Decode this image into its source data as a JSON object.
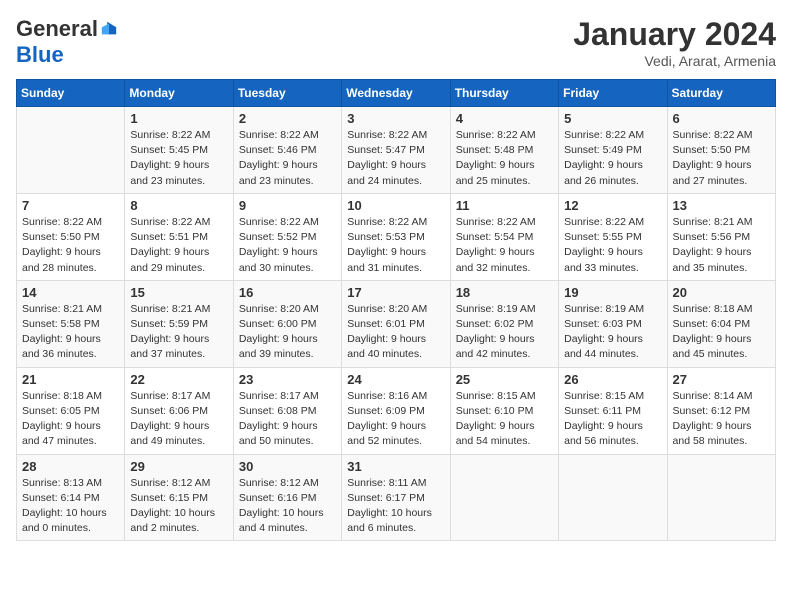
{
  "header": {
    "logo_general": "General",
    "logo_blue": "Blue",
    "month_title": "January 2024",
    "location": "Vedi, Ararat, Armenia"
  },
  "weekdays": [
    "Sunday",
    "Monday",
    "Tuesday",
    "Wednesday",
    "Thursday",
    "Friday",
    "Saturday"
  ],
  "weeks": [
    [
      {
        "day": "",
        "info": ""
      },
      {
        "day": "1",
        "info": "Sunrise: 8:22 AM\nSunset: 5:45 PM\nDaylight: 9 hours\nand 23 minutes."
      },
      {
        "day": "2",
        "info": "Sunrise: 8:22 AM\nSunset: 5:46 PM\nDaylight: 9 hours\nand 23 minutes."
      },
      {
        "day": "3",
        "info": "Sunrise: 8:22 AM\nSunset: 5:47 PM\nDaylight: 9 hours\nand 24 minutes."
      },
      {
        "day": "4",
        "info": "Sunrise: 8:22 AM\nSunset: 5:48 PM\nDaylight: 9 hours\nand 25 minutes."
      },
      {
        "day": "5",
        "info": "Sunrise: 8:22 AM\nSunset: 5:49 PM\nDaylight: 9 hours\nand 26 minutes."
      },
      {
        "day": "6",
        "info": "Sunrise: 8:22 AM\nSunset: 5:50 PM\nDaylight: 9 hours\nand 27 minutes."
      }
    ],
    [
      {
        "day": "7",
        "info": "Sunrise: 8:22 AM\nSunset: 5:50 PM\nDaylight: 9 hours\nand 28 minutes."
      },
      {
        "day": "8",
        "info": "Sunrise: 8:22 AM\nSunset: 5:51 PM\nDaylight: 9 hours\nand 29 minutes."
      },
      {
        "day": "9",
        "info": "Sunrise: 8:22 AM\nSunset: 5:52 PM\nDaylight: 9 hours\nand 30 minutes."
      },
      {
        "day": "10",
        "info": "Sunrise: 8:22 AM\nSunset: 5:53 PM\nDaylight: 9 hours\nand 31 minutes."
      },
      {
        "day": "11",
        "info": "Sunrise: 8:22 AM\nSunset: 5:54 PM\nDaylight: 9 hours\nand 32 minutes."
      },
      {
        "day": "12",
        "info": "Sunrise: 8:22 AM\nSunset: 5:55 PM\nDaylight: 9 hours\nand 33 minutes."
      },
      {
        "day": "13",
        "info": "Sunrise: 8:21 AM\nSunset: 5:56 PM\nDaylight: 9 hours\nand 35 minutes."
      }
    ],
    [
      {
        "day": "14",
        "info": "Sunrise: 8:21 AM\nSunset: 5:58 PM\nDaylight: 9 hours\nand 36 minutes."
      },
      {
        "day": "15",
        "info": "Sunrise: 8:21 AM\nSunset: 5:59 PM\nDaylight: 9 hours\nand 37 minutes."
      },
      {
        "day": "16",
        "info": "Sunrise: 8:20 AM\nSunset: 6:00 PM\nDaylight: 9 hours\nand 39 minutes."
      },
      {
        "day": "17",
        "info": "Sunrise: 8:20 AM\nSunset: 6:01 PM\nDaylight: 9 hours\nand 40 minutes."
      },
      {
        "day": "18",
        "info": "Sunrise: 8:19 AM\nSunset: 6:02 PM\nDaylight: 9 hours\nand 42 minutes."
      },
      {
        "day": "19",
        "info": "Sunrise: 8:19 AM\nSunset: 6:03 PM\nDaylight: 9 hours\nand 44 minutes."
      },
      {
        "day": "20",
        "info": "Sunrise: 8:18 AM\nSunset: 6:04 PM\nDaylight: 9 hours\nand 45 minutes."
      }
    ],
    [
      {
        "day": "21",
        "info": "Sunrise: 8:18 AM\nSunset: 6:05 PM\nDaylight: 9 hours\nand 47 minutes."
      },
      {
        "day": "22",
        "info": "Sunrise: 8:17 AM\nSunset: 6:06 PM\nDaylight: 9 hours\nand 49 minutes."
      },
      {
        "day": "23",
        "info": "Sunrise: 8:17 AM\nSunset: 6:08 PM\nDaylight: 9 hours\nand 50 minutes."
      },
      {
        "day": "24",
        "info": "Sunrise: 8:16 AM\nSunset: 6:09 PM\nDaylight: 9 hours\nand 52 minutes."
      },
      {
        "day": "25",
        "info": "Sunrise: 8:15 AM\nSunset: 6:10 PM\nDaylight: 9 hours\nand 54 minutes."
      },
      {
        "day": "26",
        "info": "Sunrise: 8:15 AM\nSunset: 6:11 PM\nDaylight: 9 hours\nand 56 minutes."
      },
      {
        "day": "27",
        "info": "Sunrise: 8:14 AM\nSunset: 6:12 PM\nDaylight: 9 hours\nand 58 minutes."
      }
    ],
    [
      {
        "day": "28",
        "info": "Sunrise: 8:13 AM\nSunset: 6:14 PM\nDaylight: 10 hours\nand 0 minutes."
      },
      {
        "day": "29",
        "info": "Sunrise: 8:12 AM\nSunset: 6:15 PM\nDaylight: 10 hours\nand 2 minutes."
      },
      {
        "day": "30",
        "info": "Sunrise: 8:12 AM\nSunset: 6:16 PM\nDaylight: 10 hours\nand 4 minutes."
      },
      {
        "day": "31",
        "info": "Sunrise: 8:11 AM\nSunset: 6:17 PM\nDaylight: 10 hours\nand 6 minutes."
      },
      {
        "day": "",
        "info": ""
      },
      {
        "day": "",
        "info": ""
      },
      {
        "day": "",
        "info": ""
      }
    ]
  ]
}
